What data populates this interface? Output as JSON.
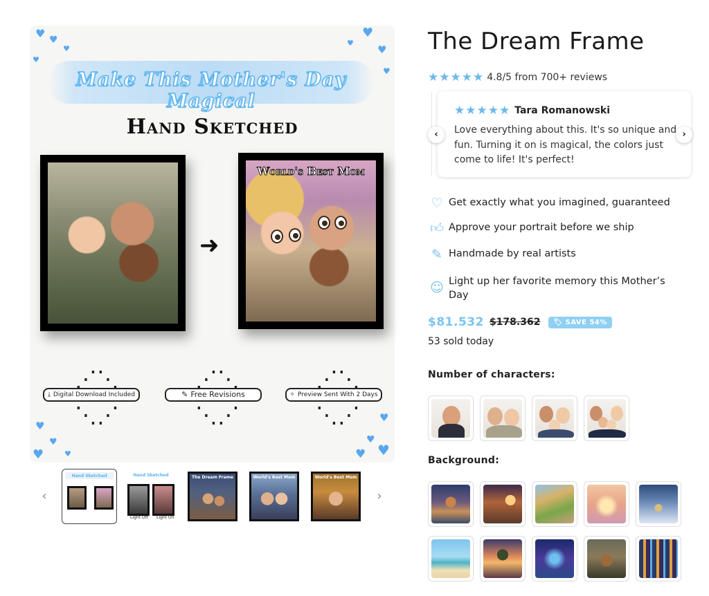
{
  "gallery": {
    "banner_text": "Make This Mother's Day Magical",
    "subtitle": "Hand Sketched",
    "toon_caption": "World's Best Mom",
    "badges": [
      "Digital Download Included",
      "Free Revisions",
      "Preview Sent With 2 Days"
    ],
    "thumbnails": [
      {
        "caption": "Hand Sketched",
        "labels": []
      },
      {
        "caption": "Hand Sketched",
        "labels": [
          "Light Off",
          "Light On"
        ]
      },
      {
        "caption": "The Dream Frame",
        "labels": []
      },
      {
        "caption": "World's Best Mom",
        "labels": []
      },
      {
        "caption": "World's Best Mom",
        "labels": []
      }
    ]
  },
  "product": {
    "title": "The Dream Frame",
    "rating_text": "4.8/5 from 700+ reviews",
    "stars": "★★★★★",
    "review": {
      "author": "Tara Romanowski",
      "text": "Love everything about this. It's so unique and fun. Turning it on is magical, the colors just come to life! It's perfect!"
    },
    "features": [
      {
        "icon": "heart-icon",
        "text": "Get exactly what you imagined, guaranteed"
      },
      {
        "icon": "thumbs-up-icon",
        "text": "Approve your portrait before we ship"
      },
      {
        "icon": "pencil-icon",
        "text": "Handmade by real artists"
      },
      {
        "icon": "smile-icon",
        "text": "Light up her favorite memory this Mother’s Day"
      }
    ],
    "price": "$81.532",
    "old_price": "$178.362",
    "save_badge": "SAVE 54%",
    "sold_text": "53 sold today",
    "characters_label": "Number of characters:",
    "background_label": "Background:"
  },
  "colors": {
    "accent": "#7cc3f0",
    "badge": "#8fd0f3",
    "heart": "#5aa7ee"
  }
}
